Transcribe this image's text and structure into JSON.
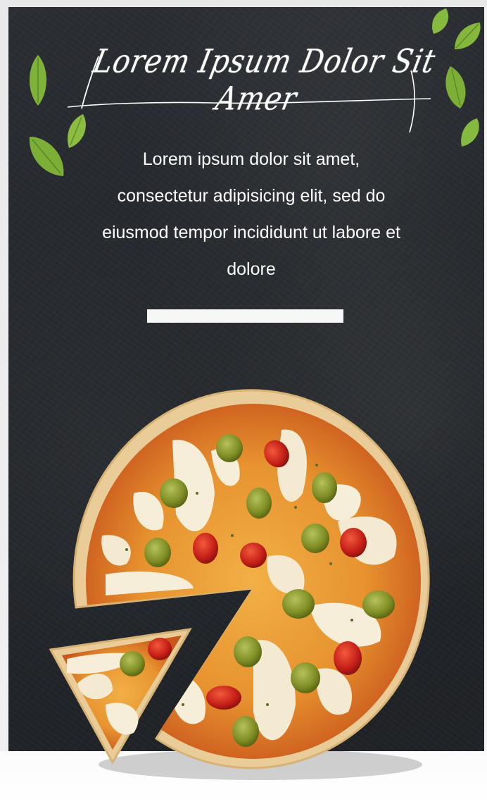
{
  "hero": {
    "script_title": "Lorem Ipsum Dolor Sit Amer",
    "body_lines": [
      "Lorem ipsum dolor sit amet,",
      "consectetur adipisicing elit, sed do",
      "eiusmod tempor incididunt ut labore et",
      "dolore"
    ]
  },
  "colors": {
    "background": "#26292d",
    "text": "#ffffff",
    "divider": "#f7f7f8",
    "leaf": "#7fb23a",
    "crust": "#e8c98f",
    "sauce": "#d9772a",
    "olive": "#8a9a2e",
    "tomato": "#c8201a"
  },
  "images": {
    "main": "pizza-image",
    "slice": "pizza-slice-image",
    "decoration": "basil-leaf-icon"
  }
}
